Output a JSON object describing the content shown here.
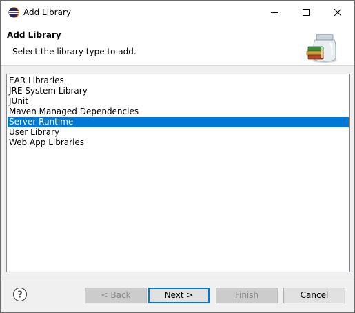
{
  "window": {
    "title": "Add Library",
    "icons": {
      "app": "eclipse-icon",
      "minimize": "minimize-icon",
      "maximize": "maximize-icon",
      "close": "close-icon"
    }
  },
  "banner": {
    "title": "Add Library",
    "description": "Select the library type to add.",
    "icon": "library-jar-icon"
  },
  "library_types": [
    {
      "label": "EAR Libraries",
      "selected": false
    },
    {
      "label": "JRE System Library",
      "selected": false
    },
    {
      "label": "JUnit",
      "selected": false
    },
    {
      "label": "Maven Managed Dependencies",
      "selected": false
    },
    {
      "label": "Server Runtime",
      "selected": true
    },
    {
      "label": "User Library",
      "selected": false
    },
    {
      "label": "Web App Libraries",
      "selected": false
    }
  ],
  "footer": {
    "help_icon": "help-icon",
    "back_label": "< Back",
    "next_label": "Next >",
    "finish_label": "Finish",
    "cancel_label": "Cancel"
  },
  "colors": {
    "selection": "#0078d7",
    "selection_text": "#ffffff"
  }
}
